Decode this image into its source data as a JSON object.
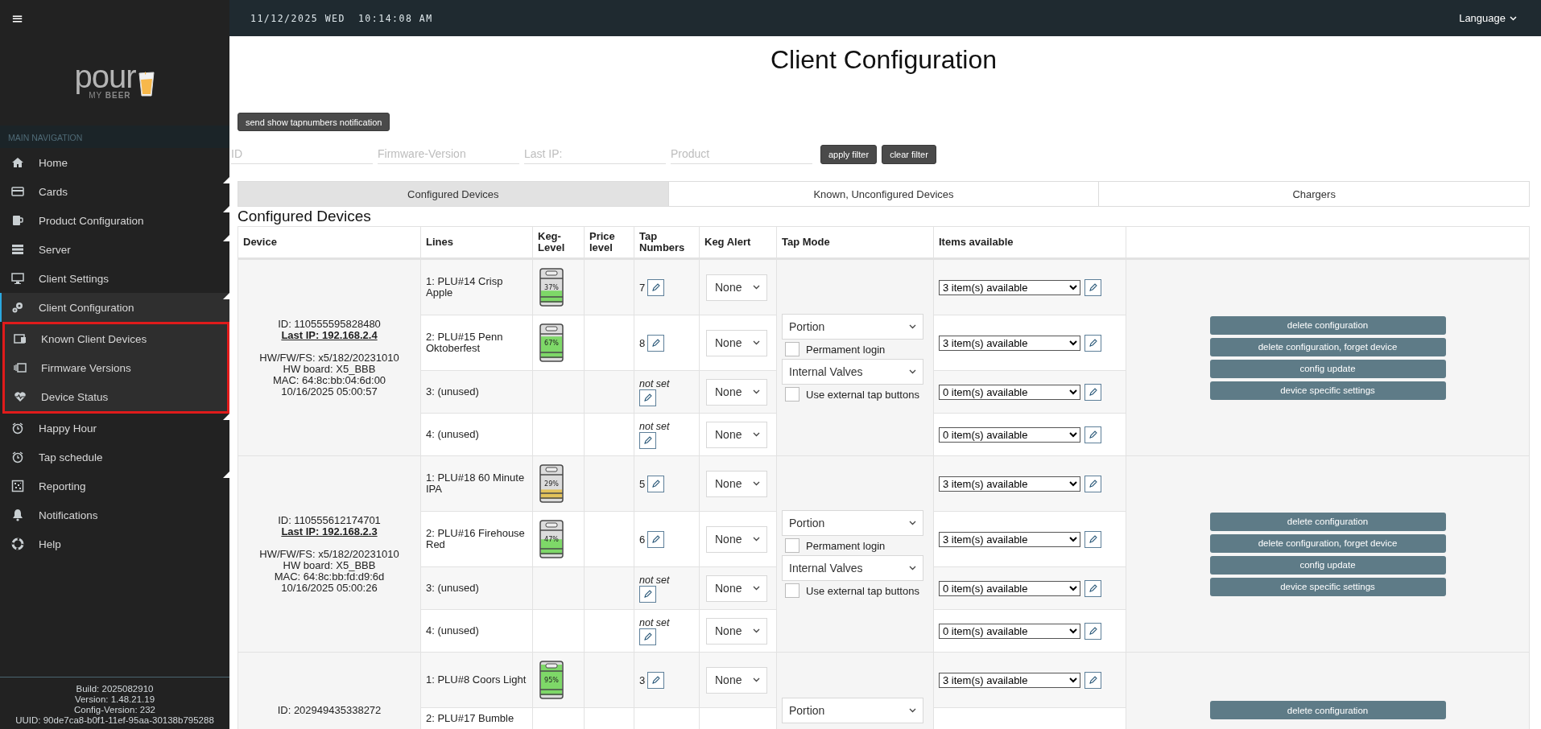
{
  "sidebar": {
    "menu_glyph": "≡",
    "logo": {
      "word": "pour",
      "tagline": "MY **BEER**"
    },
    "section_title": "MAIN NAVIGATION",
    "items": [
      {
        "label": "Home",
        "selected": false,
        "has_submenu": false
      },
      {
        "label": "Cards",
        "selected": false,
        "has_submenu": true
      },
      {
        "label": "Product Configuration",
        "selected": false,
        "has_submenu": true
      },
      {
        "label": "Server",
        "selected": false,
        "has_submenu": true
      },
      {
        "label": "Client Settings",
        "selected": false,
        "has_submenu": false
      },
      {
        "label": "Client Configuration",
        "selected": true,
        "has_submenu": true,
        "expanded": true,
        "highlighted": true,
        "children": [
          {
            "label": "Known Client Devices",
            "selected": false
          },
          {
            "label": "Firmware Versions",
            "selected": false
          },
          {
            "label": "Device Status",
            "selected": false
          }
        ]
      },
      {
        "label": "Happy Hour",
        "selected": false,
        "has_submenu": true
      },
      {
        "label": "Tap schedule",
        "selected": false,
        "has_submenu": false
      },
      {
        "label": "Reporting",
        "selected": false,
        "has_submenu": true
      },
      {
        "label": "Notifications",
        "selected": false,
        "has_submenu": false
      },
      {
        "label": "Help",
        "selected": false,
        "has_submenu": false
      }
    ],
    "footer": [
      "Build: 2025082910",
      "Version: 1.48.21.19",
      "Config-Version: 232",
      "UUID: 90de7ca8-b0f1-11ef-95aa-30138b795288"
    ]
  },
  "header": {
    "date": "11/12/2025 WED",
    "time": "10:14:08 AM",
    "language": "Language"
  },
  "page_title": "Client Configuration",
  "notify_button": "send show tapnumbers notification",
  "filters": {
    "fields": [
      {
        "placeholder": "ID"
      },
      {
        "placeholder": "Firmware-Version"
      },
      {
        "placeholder": "Last IP:"
      },
      {
        "placeholder": "Product"
      }
    ],
    "buttons": [
      "apply filter",
      "clear filter"
    ]
  },
  "tabs": [
    {
      "label": "Configured Devices",
      "selected": true
    },
    {
      "label": "Known, Unconfigured Devices",
      "selected": false
    },
    {
      "label": "Chargers",
      "selected": false
    }
  ],
  "section_heading": "Configured Devices",
  "table": {
    "columns": [
      "Device",
      "Lines",
      "Keg-Level",
      "Price level",
      "Tap Numbers",
      "Keg Alert",
      "Tap Mode",
      "Items available"
    ],
    "devices": [
      {
        "id": "ID: 110555595828480",
        "last_ip": "Last IP: 192.168.2.4",
        "info": [
          "HW/FW/FS: x5/182/20231010",
          "HW board: X5_BBB",
          "MAC: 64:8c:bb:04:6d:00",
          "10/16/2025 05:00:57"
        ],
        "lines": [
          {
            "kind": "product",
            "label": "1: PLU#14 Crisp Apple",
            "keg": {
              "level": 0.37,
              "reading": "37%",
              "color": "#7ed868"
            },
            "tap_number": "7",
            "keg_alert": "None",
            "items": "3 item(s) available"
          },
          {
            "kind": "product",
            "label": "2: PLU#15 Penn Oktoberfest",
            "keg": {
              "level": 0.67,
              "reading": "67%",
              "color": "#7ed868"
            },
            "tap_number": "8",
            "keg_alert": "None",
            "items": "3 item(s) available"
          },
          {
            "kind": "unused",
            "label": "3: (unused)",
            "tap_number": "not set",
            "keg_alert": "None",
            "items": "0 item(s) available"
          },
          {
            "kind": "unused",
            "label": "4: (unused)",
            "tap_number": "not set",
            "keg_alert": "None",
            "items": "0 item(s) available"
          }
        ],
        "tap_mode": {
          "mode": "Portion",
          "permanent_login": {
            "label": "Permament login",
            "checked": false
          },
          "valves": "Internal Valves",
          "external_buttons": {
            "label": "Use external tap buttons",
            "checked": false
          }
        },
        "actions": [
          "delete configuration",
          "delete configuration, forget device",
          "config update",
          "device specific settings"
        ]
      },
      {
        "id": "ID: 110555612174701",
        "last_ip": "Last IP: 192.168.2.3",
        "info": [
          "HW/FW/FS: x5/182/20231010",
          "HW board: X5_BBB",
          "MAC: 64:8c:bb:fd:d9:6d",
          "10/16/2025 05:00:26"
        ],
        "lines": [
          {
            "kind": "product",
            "label": "1: PLU#18 60 Minute IPA",
            "keg": {
              "level": 0.29,
              "reading": "29%",
              "color": "#e2c25a"
            },
            "tap_number": "5",
            "keg_alert": "None",
            "items": "3 item(s) available"
          },
          {
            "kind": "product",
            "label": "2: PLU#16 Firehouse Red",
            "keg": {
              "level": 0.47,
              "reading": "47%",
              "color": "#7ed868"
            },
            "tap_number": "6",
            "keg_alert": "None",
            "items": "3 item(s) available"
          },
          {
            "kind": "unused",
            "label": "3: (unused)",
            "tap_number": "not set",
            "keg_alert": "None",
            "items": "0 item(s) available"
          },
          {
            "kind": "unused",
            "label": "4: (unused)",
            "tap_number": "not set",
            "keg_alert": "None",
            "items": "0 item(s) available"
          }
        ],
        "tap_mode": {
          "mode": "Portion",
          "permanent_login": {
            "label": "Permament login",
            "checked": false
          },
          "valves": "Internal Valves",
          "external_buttons": {
            "label": "Use external tap buttons",
            "checked": false
          }
        },
        "actions": [
          "delete configuration",
          "delete configuration, forget device",
          "config update",
          "device specific settings"
        ]
      },
      {
        "id": "ID: 202949435338272",
        "lines": [
          {
            "kind": "product",
            "label": "1: PLU#8 Coors Light",
            "keg": {
              "level": 0.95,
              "reading": "95%",
              "color": "#7ed868"
            },
            "tap_number": "3",
            "keg_alert": "None",
            "items": "3 item(s) available"
          },
          {
            "kind": "partial",
            "label": "2: PLU#17 Bumble"
          }
        ],
        "tap_mode": {
          "mode": "Portion"
        },
        "actions": [
          "delete configuration"
        ]
      }
    ]
  }
}
